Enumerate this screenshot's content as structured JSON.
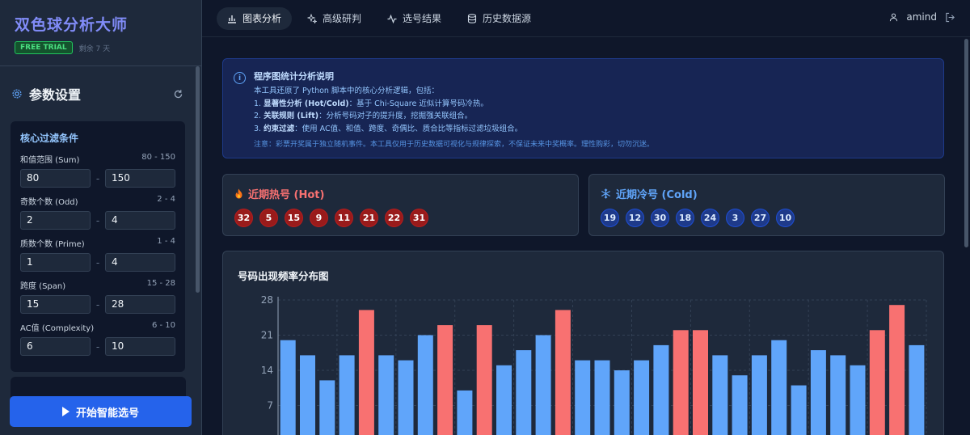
{
  "brand": {
    "title": "双色球分析大师",
    "badge": "FREE TRIAL",
    "remaining": "剩余 7 天"
  },
  "sidebar": {
    "params_title": "参数设置",
    "filter_title": "核心过滤条件",
    "filters": [
      {
        "label": "和值范围 (Sum)",
        "range": "80 - 150",
        "min": "80",
        "max": "150"
      },
      {
        "label": "奇数个数 (Odd)",
        "range": "2 - 4",
        "min": "2",
        "max": "4"
      },
      {
        "label": "质数个数 (Prime)",
        "range": "1 - 4",
        "min": "1",
        "max": "4"
      },
      {
        "label": "跨度 (Span)",
        "range": "15 - 28",
        "min": "15",
        "max": "28"
      },
      {
        "label": "AC值 (Complexity)",
        "range": "6 - 10",
        "min": "6",
        "max": "10"
      }
    ],
    "start_button": "开始智能选号",
    "dash": "-"
  },
  "tabs": [
    {
      "label": "图表分析",
      "icon": "bar-chart-icon",
      "active": true
    },
    {
      "label": "高级研判",
      "icon": "sparkles-icon",
      "active": false
    },
    {
      "label": "选号结果",
      "icon": "activity-icon",
      "active": false
    },
    {
      "label": "历史数据源",
      "icon": "database-icon",
      "active": false
    }
  ],
  "user": {
    "name": "amind"
  },
  "info": {
    "title": "程序图统计分析说明",
    "intro": "本工具还原了 Python 脚本中的核心分析逻辑，包括：",
    "items": [
      {
        "num": "1.",
        "bold": "显著性分析 (Hot/Cold)",
        "text": "：基于 Chi-Square 近似计算号码冷热。"
      },
      {
        "num": "2.",
        "bold": "关联规则 (Lift)",
        "text": "：分析号码对子的提升度，挖掘强关联组合。"
      },
      {
        "num": "3.",
        "bold": "约束过滤",
        "text": "：使用 AC值、和值、跨度、奇偶比、质合比等指标过滤垃圾组合。"
      }
    ],
    "note": "注意：彩票开奖属于独立随机事件。本工具仅用于历史数据可视化与规律探索，不保证未来中奖概率。理性购彩，切勿沉迷。"
  },
  "hot": {
    "title": "近期热号 (Hot)",
    "numbers": [
      "32",
      "5",
      "15",
      "9",
      "11",
      "21",
      "22",
      "31"
    ]
  },
  "cold": {
    "title": "近期冷号 (Cold)",
    "numbers": [
      "19",
      "12",
      "30",
      "18",
      "24",
      "3",
      "27",
      "10"
    ]
  },
  "colors": {
    "hot_bar": "#f87171",
    "normal_bar": "#60a5fa",
    "grid": "#334155",
    "axis_text": "#94a3b8"
  },
  "chart_data": {
    "type": "bar",
    "title": "号码出现频率分布图",
    "ylim": [
      0,
      28
    ],
    "yticks": [
      7,
      14,
      21,
      28
    ],
    "grid": true,
    "values": [
      20,
      17,
      12,
      17,
      26,
      17,
      16,
      21,
      23,
      10,
      23,
      15,
      18,
      21,
      26,
      16,
      16,
      14,
      16,
      19,
      22,
      22,
      17,
      13,
      17,
      20,
      11,
      18,
      17,
      15,
      22,
      27,
      19
    ],
    "hot": [
      false,
      false,
      false,
      false,
      true,
      false,
      false,
      false,
      true,
      false,
      true,
      false,
      false,
      false,
      true,
      false,
      false,
      false,
      false,
      false,
      true,
      true,
      false,
      false,
      false,
      false,
      false,
      false,
      false,
      false,
      true,
      true,
      false
    ]
  }
}
